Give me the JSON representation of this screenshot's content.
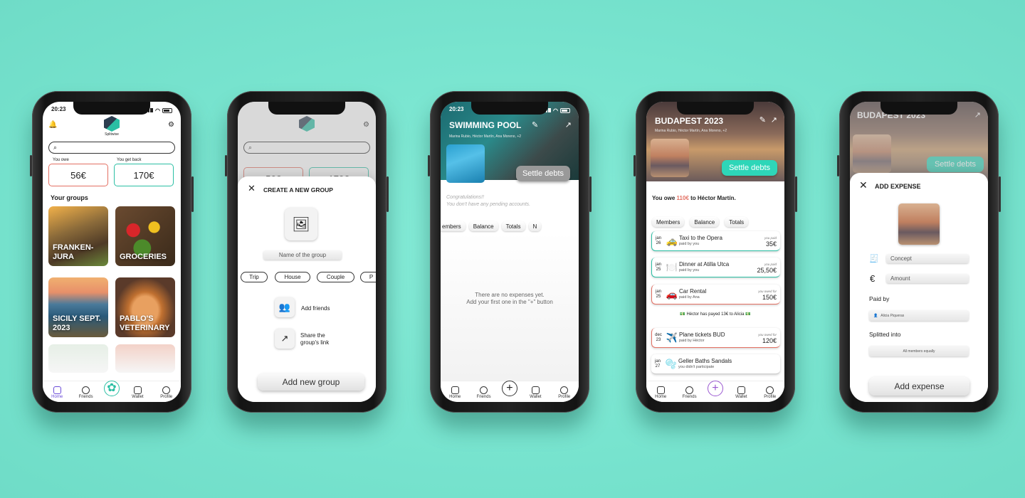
{
  "status_time": "20:23",
  "nav": {
    "home": "Home",
    "friends": "Friends",
    "wallet": "Wallet",
    "profile": "Profile",
    "fab": "+"
  },
  "home": {
    "brand": "Splitwise",
    "you_owe_label": "You owe",
    "you_owe_value": "56€",
    "you_get_back_label": "You get back",
    "you_get_back_value": "170€",
    "your_groups": "Your groups",
    "groups": [
      "FRANKEN-JURA",
      "GROCERIES",
      "SICILY SEPT. 2023",
      "PABLO'S VETERINARY"
    ]
  },
  "create_group": {
    "title": "CREATE A NEW GROUP",
    "name_placeholder": "Name of the group",
    "types": [
      "Trip",
      "House",
      "Couple",
      "P"
    ],
    "add_friends": "Add friends",
    "share_link": "Share the group's link",
    "submit": "Add new group",
    "bg_owe": "56€",
    "bg_back": "170€"
  },
  "pool": {
    "title": "SWIMMING POOL",
    "members": "Marina Rubio, Héctor Martín, Ana Moreno, +2",
    "settle": "Settle debts",
    "congrats": "Congratulations!!",
    "no_pending": "You don't have any pending accounts.",
    "tabs": [
      "embers",
      "Balance",
      "Totals",
      "N"
    ],
    "empty_line1": "There are no expenses yet.",
    "empty_line2": "Add your first one in the \"+\" button"
  },
  "budapest": {
    "title": "BUDAPEST 2023",
    "members": "Marina Rubio, Héctor Martín, Ana Moreno, +2",
    "settle": "Settle debts",
    "owe_prefix": "You owe ",
    "owe_amount": "110€",
    "owe_suffix": " to Héctor Martín.",
    "tabs": [
      "Members",
      "Balance",
      "Totals"
    ],
    "expenses": [
      {
        "month": "jan",
        "day": "26",
        "icon": "🚕",
        "title": "Taxi to the Opera",
        "sub": "paid by you",
        "note": "you paid",
        "amount": "35€",
        "color": "teal"
      },
      {
        "month": "jan",
        "day": "25",
        "icon": "🍽️",
        "title": "Dinner at Atilla Utca",
        "sub": "paid by you",
        "note": "you paid",
        "amount": "25,50€",
        "color": "teal"
      },
      {
        "month": "jan",
        "day": "25",
        "icon": "🚗",
        "title": "Car Rental",
        "sub": "paid by Ana",
        "note": "you owed for",
        "amount": "150€",
        "color": "red"
      },
      {
        "month": "dec",
        "day": "23",
        "icon": "✈️",
        "title": "Plane tickets BUD",
        "sub": "paid by Héctor",
        "note": "you owed for",
        "amount": "120€",
        "color": "red"
      },
      {
        "month": "jan",
        "day": "27",
        "icon": "🫧",
        "title": "Geller Baths Sandals",
        "sub": "you didn't participate",
        "note": "",
        "amount": "",
        "color": "grey"
      }
    ],
    "payment_note": "Héctor has payed 13€ to Alicia"
  },
  "add_expense": {
    "bg_title": "BUDAPEST 2023",
    "bg_settle": "Settle debts",
    "title": "ADD EXPENSE",
    "concept": "Concept",
    "amount": "Amount",
    "paid_by_label": "Paid by",
    "paid_by_value": "Alicia Piqueras",
    "split_label": "Splitted into",
    "split_value": "All members equally",
    "submit": "Add expense"
  }
}
